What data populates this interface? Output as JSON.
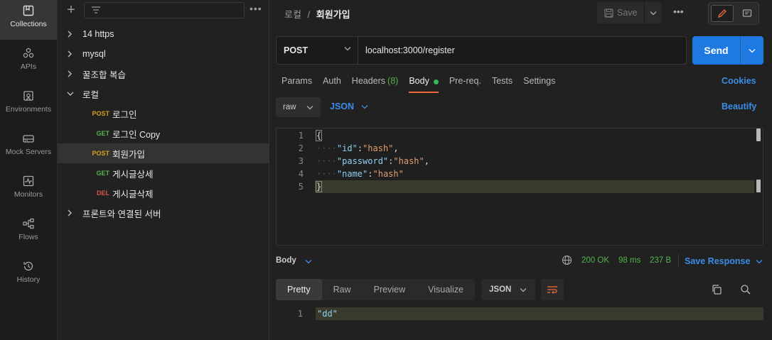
{
  "rail": [
    {
      "label": "Collections",
      "icon": "collections-icon",
      "active": true
    },
    {
      "label": "APIs",
      "icon": "apis-icon"
    },
    {
      "label": "Environments",
      "icon": "environments-icon"
    },
    {
      "label": "Mock Servers",
      "icon": "mock-servers-icon"
    },
    {
      "label": "Monitors",
      "icon": "monitors-icon"
    },
    {
      "label": "Flows",
      "icon": "flows-icon"
    },
    {
      "label": "History",
      "icon": "history-icon"
    }
  ],
  "sidebar": {
    "more": "•••",
    "items": [
      {
        "label": "14 https",
        "type": "folder"
      },
      {
        "label": "mysql",
        "type": "folder"
      },
      {
        "label": "꿀조합 복습",
        "type": "folder"
      },
      {
        "label": "로컬",
        "type": "folder-open"
      },
      {
        "label": "로그인",
        "method": "POST"
      },
      {
        "label": "로그인 Copy",
        "method": "GET"
      },
      {
        "label": "회원가입",
        "method": "POST",
        "selected": true
      },
      {
        "label": "게시글상세",
        "method": "GET"
      },
      {
        "label": "게시글삭제",
        "method": "DEL"
      },
      {
        "label": "프론트와 연결된 서버",
        "type": "folder"
      }
    ]
  },
  "header": {
    "breadcrumb_parent": "로컬",
    "breadcrumb_sep": "/",
    "breadcrumb_current": "회원가입",
    "save_label": "Save",
    "more": "•••"
  },
  "request": {
    "method": "POST",
    "url": "localhost:3000/register",
    "send_label": "Send"
  },
  "tabs": {
    "params": "Params",
    "auth": "Auth",
    "headers": "Headers",
    "headers_count": "(8)",
    "body": "Body",
    "prereq": "Pre-req.",
    "tests": "Tests",
    "settings": "Settings",
    "cookies": "Cookies"
  },
  "body_opts": {
    "mode": "raw",
    "lang": "JSON",
    "beautify": "Beautify"
  },
  "editor": {
    "ln": [
      "1",
      "2",
      "3",
      "4",
      "5"
    ],
    "open": "{",
    "close": "}",
    "dots": "····",
    "lines": [
      {
        "key": "\"id\"",
        "colon": ":",
        "val": "\"hash\"",
        "comma": ","
      },
      {
        "key": "\"password\"",
        "colon": ":",
        "val": "\"hash\"",
        "comma": ","
      },
      {
        "key": "\"name\"",
        "colon": ":",
        "val": "\"hash\"",
        "comma": ""
      }
    ]
  },
  "response": {
    "body_label": "Body",
    "status": "200 OK",
    "time": "98 ms",
    "size": "237 B",
    "save_response": "Save Response",
    "views": [
      "Pretty",
      "Raw",
      "Preview",
      "Visualize"
    ],
    "format": "JSON",
    "ln": "1",
    "value": "\"dd\""
  },
  "colors": {
    "accent_blue": "#1e7ae0",
    "link_blue": "#3a8ee6",
    "success_green": "#53b34d",
    "tab_underline": "#f26b3a"
  }
}
